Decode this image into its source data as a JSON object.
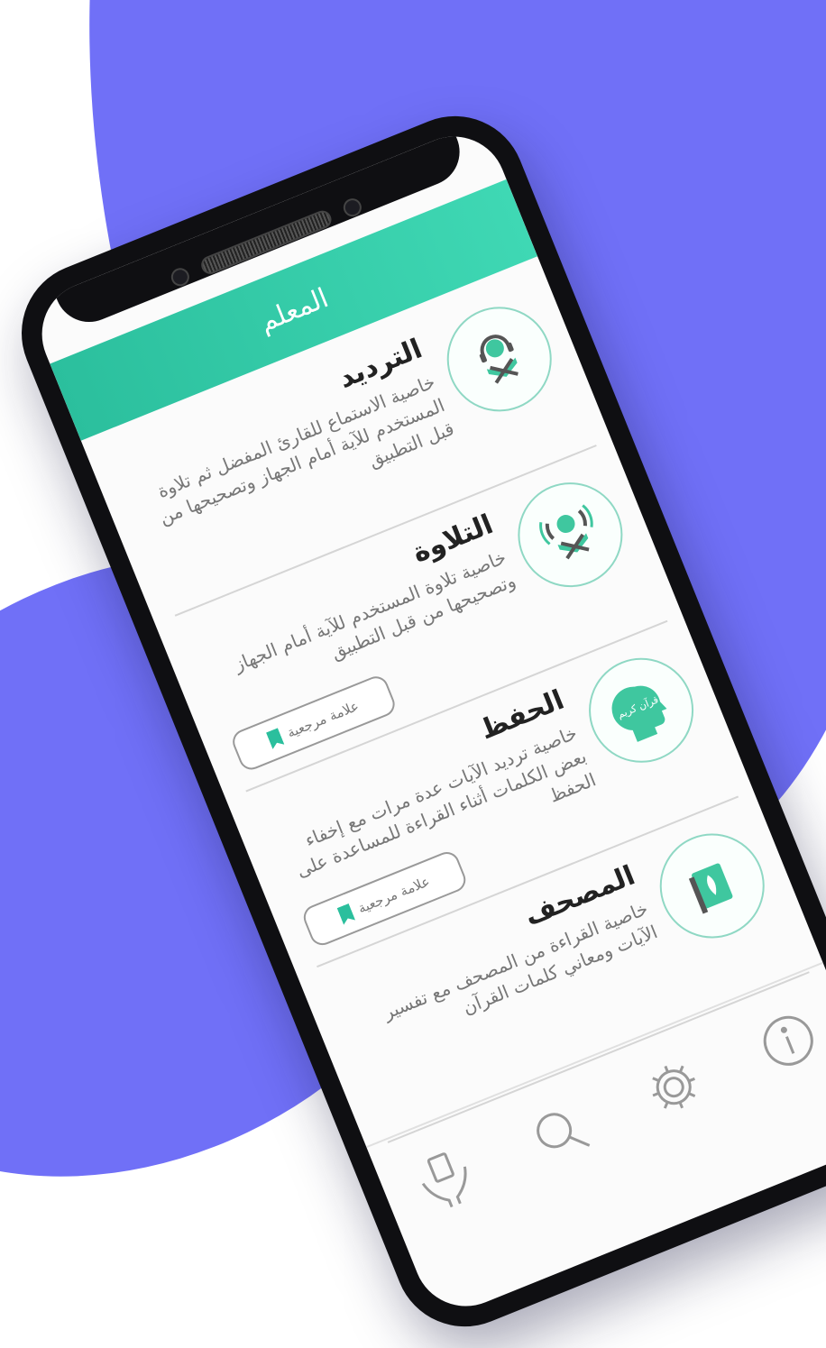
{
  "colors": {
    "background_blob": "#7070f7",
    "header": "#2bbf9d",
    "accent": "#2bbf9d",
    "phone_frame": "#0f0f12"
  },
  "header": {
    "title": "المعلم"
  },
  "features": [
    {
      "icon": "headphones-reader-icon",
      "title": "الترديد",
      "description": "خاصية الاستماع للقارئ المفضل ثم تلاوة المستخدم للآية أمام الجهاز وتصحيحها من قبل التطبيق",
      "bookmark": null
    },
    {
      "icon": "reciting-reader-icon",
      "title": "التلاوة",
      "description": "خاصية تلاوة المستخدم للآية أمام الجهاز وتصحيحها من قبل التطبيق",
      "bookmark": "علامة مرجعية"
    },
    {
      "icon": "quran-head-icon",
      "icon_text": "قرآن كريم",
      "title": "الحفظ",
      "description": "خاصية ترديد الآيات عدة مرات مع إخفاء بعض الكلمات أثناء القراءة للمساعدة على الحفظ",
      "bookmark": "علامة مرجعية"
    },
    {
      "icon": "mushaf-book-icon",
      "title": "المصحف",
      "description": "خاصية القراءة من المصحف مع تفسير الآيات ومعاني كلمات القرآن",
      "bookmark": null
    }
  ],
  "tabbar": {
    "items": [
      "hands-quran-icon",
      "search-icon",
      "settings-gear-icon",
      "info-icon"
    ]
  }
}
